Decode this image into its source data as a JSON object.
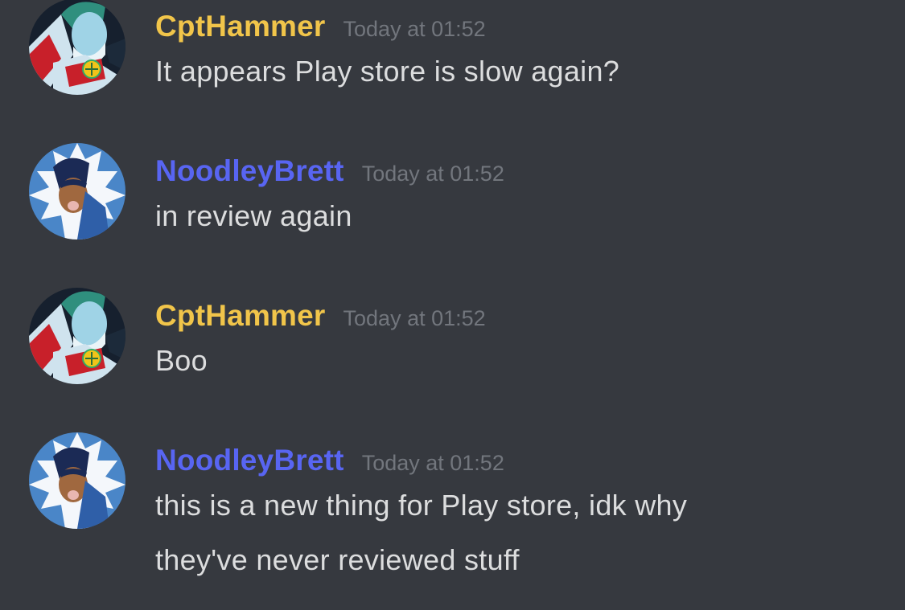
{
  "colors": {
    "background": "#36393f",
    "message_text": "#dcddde",
    "timestamp": "#72767d",
    "cpthammer": "#f1c54a",
    "noodleybrett": "#5865f2"
  },
  "messages": [
    {
      "author": "CptHammer",
      "author_color": "#f1c54a",
      "avatar_icon": "captain-planet-avatar",
      "timestamp": "Today at 01:52",
      "lines": [
        "It appears Play store is slow again?"
      ]
    },
    {
      "author": "NoodleyBrett",
      "author_color": "#5865f2",
      "avatar_icon": "noodleybrett-avatar",
      "timestamp": "Today at 01:52",
      "lines": [
        "in review again"
      ]
    },
    {
      "author": "CptHammer",
      "author_color": "#f1c54a",
      "avatar_icon": "captain-planet-avatar",
      "timestamp": "Today at 01:52",
      "lines": [
        "Boo"
      ]
    },
    {
      "author": "NoodleyBrett",
      "author_color": "#5865f2",
      "avatar_icon": "noodleybrett-avatar",
      "timestamp": "Today at 01:52",
      "lines": [
        "this is a new thing for Play store, idk why",
        "they've never reviewed stuff"
      ]
    }
  ]
}
